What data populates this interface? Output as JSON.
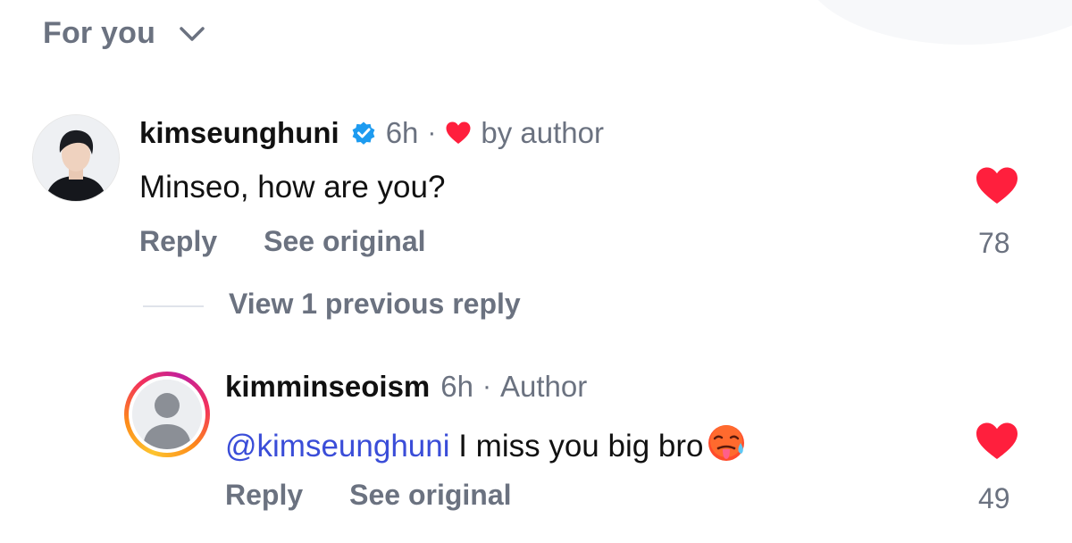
{
  "sort": {
    "label": "For you"
  },
  "comments": [
    {
      "username": "kimseunghuni",
      "verified": true,
      "time": "6h",
      "liked_by_author_label": "by author",
      "text": "Minseo, how are you?",
      "actions": {
        "reply": "Reply",
        "see_original": "See original"
      },
      "likes": "78",
      "liked": true
    }
  ],
  "replies_toggle": {
    "label": "View 1 previous reply"
  },
  "reply": {
    "username": "kimminseoism",
    "time": "6h",
    "badge": "Author",
    "mention": "@kimseunghuni",
    "text": " I miss you big bro",
    "emoji": "hot-face-emoji",
    "actions": {
      "reply": "Reply",
      "see_original": "See original"
    },
    "likes": "49",
    "liked": true
  },
  "colors": {
    "heart": "#ff1f3d",
    "verified": "#1d9bf0",
    "mention": "#3a4dd8",
    "muted": "#6b7280"
  }
}
